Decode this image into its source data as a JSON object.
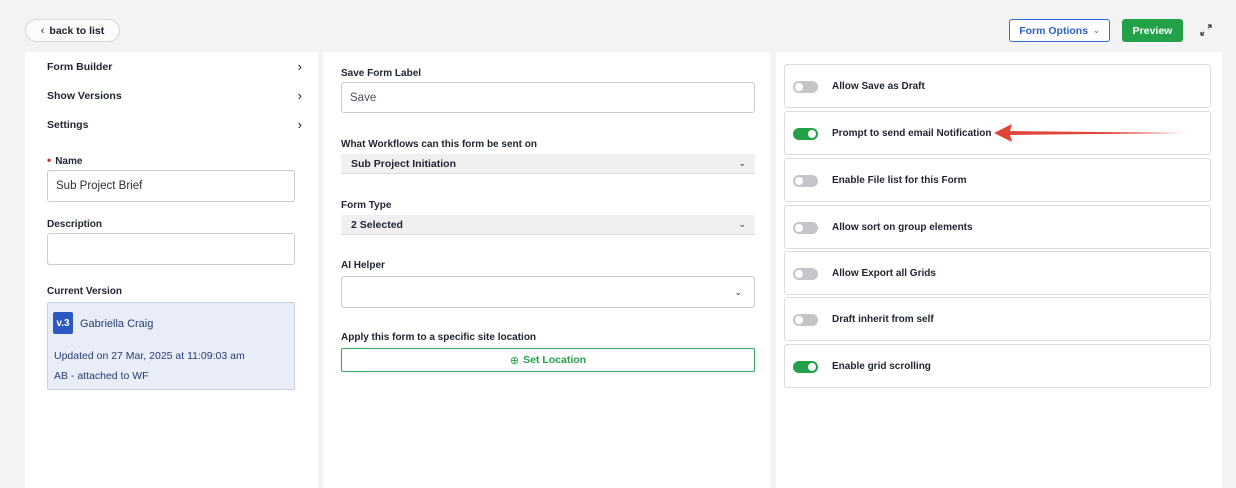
{
  "header": {
    "back_label": "back to list",
    "form_options_label": "Form Options",
    "preview_label": "Preview"
  },
  "sidebar": {
    "nav": [
      {
        "label": "Form Builder"
      },
      {
        "label": "Show Versions"
      },
      {
        "label": "Settings"
      }
    ],
    "name_label": "Name",
    "name_value": "Sub Project Brief",
    "description_label": "Description",
    "description_value": "",
    "current_version_label": "Current Version",
    "version": {
      "badge": "v.3",
      "author": "Gabriella Craig",
      "updated": "Updated on 27 Mar, 2025 at 11:09:03 am",
      "note": "AB - attached to WF"
    }
  },
  "main": {
    "save_label_title": "Save Form Label",
    "save_label_value": "Save",
    "workflows_title": "What Workflows can this form be sent on",
    "workflows_value": "Sub Project Initiation",
    "form_type_title": "Form Type",
    "form_type_value": "2 Selected",
    "ai_helper_title": "AI Helper",
    "ai_helper_value": "",
    "location_title": "Apply this form to a specific site location",
    "location_button": "Set Location"
  },
  "options": {
    "items": [
      {
        "label": "Allow Save as Draft",
        "enabled": false
      },
      {
        "label": "Prompt to send email Notification",
        "enabled": true
      },
      {
        "label": "Enable File list for this Form",
        "enabled": false
      },
      {
        "label": "Allow sort on group elements",
        "enabled": false
      },
      {
        "label": "Allow Export all Grids",
        "enabled": false
      },
      {
        "label": "Draft inherit from self",
        "enabled": false
      },
      {
        "label": "Enable grid scrolling",
        "enabled": true
      }
    ]
  },
  "annotation": {
    "arrow_color": "#e0453a"
  },
  "colors": {
    "accent_green": "#23a149",
    "accent_blue": "#2a62c7",
    "version_bg": "#e9edf7"
  }
}
